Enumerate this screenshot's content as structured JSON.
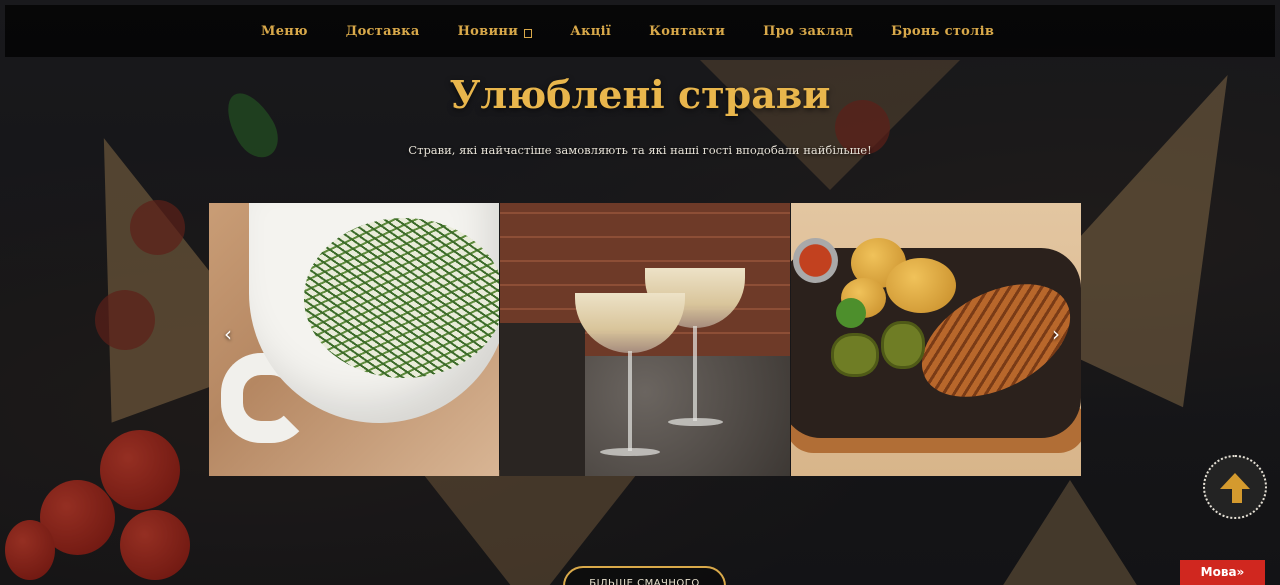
{
  "nav": {
    "items": [
      {
        "label": "Меню"
      },
      {
        "label": "Доставка"
      },
      {
        "label": "Новини",
        "icon": "dropdown-box-icon"
      },
      {
        "label": "Акції"
      },
      {
        "label": "Контакти"
      },
      {
        "label": "Про заклад"
      },
      {
        "label": "Бронь столів"
      }
    ]
  },
  "section": {
    "title": "Улюблені страви",
    "subtitle": "Страви, які найчастіше замовляють та які наші гості вподобали найбільше!"
  },
  "carousel": {
    "prev_icon": "chevron-left-icon",
    "next_icon": "chevron-right-icon",
    "prev_label": "‹",
    "next_label": "›",
    "slides": [
      {
        "icon": "soup-image"
      },
      {
        "icon": "dessert-image"
      },
      {
        "icon": "grilled-chicken-image"
      }
    ]
  },
  "more_button": {
    "label": "БІЛЬШЕ СМАЧНОГО"
  },
  "lang_button": {
    "label": "Мова»"
  },
  "colors": {
    "accent": "#d9a94a",
    "title": "#e9b64c",
    "nav_bg": "#050505",
    "lang_bg": "#d0271f"
  }
}
